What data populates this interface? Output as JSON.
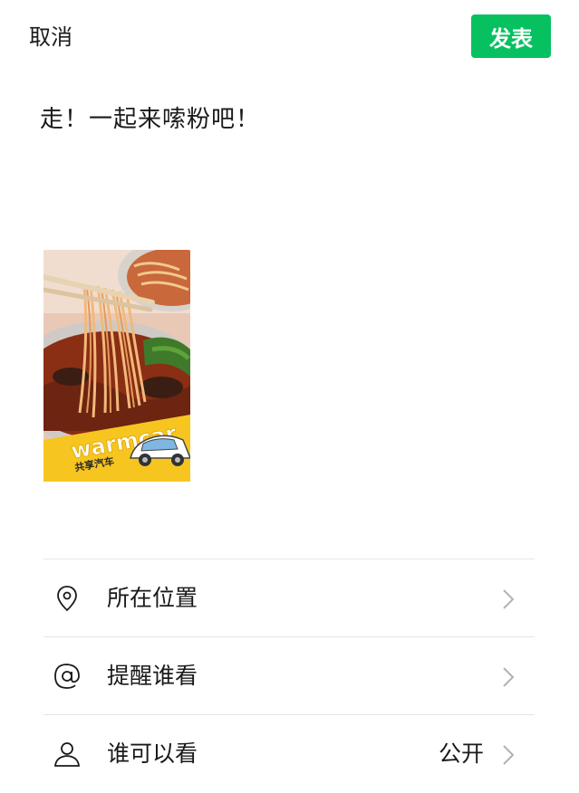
{
  "header": {
    "cancel_label": "取消",
    "publish_label": "发表"
  },
  "post": {
    "text": "走！一起来嗦粉吧！",
    "image": {
      "brand_text": "warmcar",
      "brand_subtitle": "共享汽车"
    }
  },
  "options": [
    {
      "icon": "location-pin-icon",
      "label": "所在位置",
      "value": ""
    },
    {
      "icon": "at-sign-icon",
      "label": "提醒谁看",
      "value": ""
    },
    {
      "icon": "person-icon",
      "label": "谁可以看",
      "value": "公开"
    }
  ],
  "colors": {
    "publish_bg": "#07c160",
    "divider": "#e6e6e6",
    "chevron": "#b2b2b2"
  }
}
